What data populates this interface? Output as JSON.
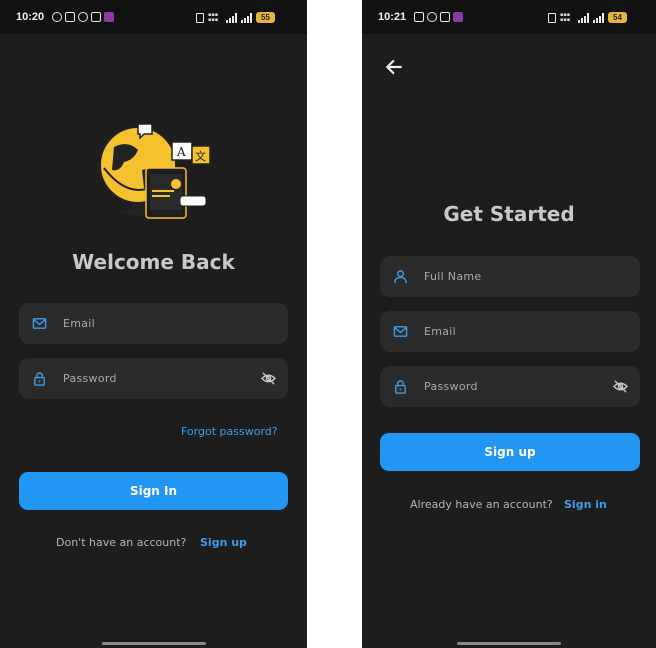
{
  "login": {
    "status": {
      "time": "10:20",
      "battery": "55"
    },
    "title": "Welcome Back",
    "email": {
      "placeholder": "Email",
      "icon": "mail-icon"
    },
    "password": {
      "placeholder": "Password",
      "icon": "lock-icon",
      "toggle_icon": "eye-off-icon"
    },
    "forgot": "Forgot password?",
    "submit": "Sign In",
    "prompt": "Don't have an account?",
    "alt_action": "Sign up",
    "accent": "#2196f3",
    "illustration_color": "#f5c12e"
  },
  "signup": {
    "status": {
      "time": "10:21",
      "battery": "54"
    },
    "back_icon": "arrow-left-icon",
    "title": "Get Started",
    "fullname": {
      "placeholder": "Full Name",
      "icon": "person-icon"
    },
    "email": {
      "placeholder": "Email",
      "icon": "mail-icon"
    },
    "password": {
      "placeholder": "Password",
      "icon": "lock-icon",
      "toggle_icon": "eye-off-icon"
    },
    "submit": "Sign up",
    "prompt": "Already have an account?",
    "alt_action": "Sign in"
  }
}
